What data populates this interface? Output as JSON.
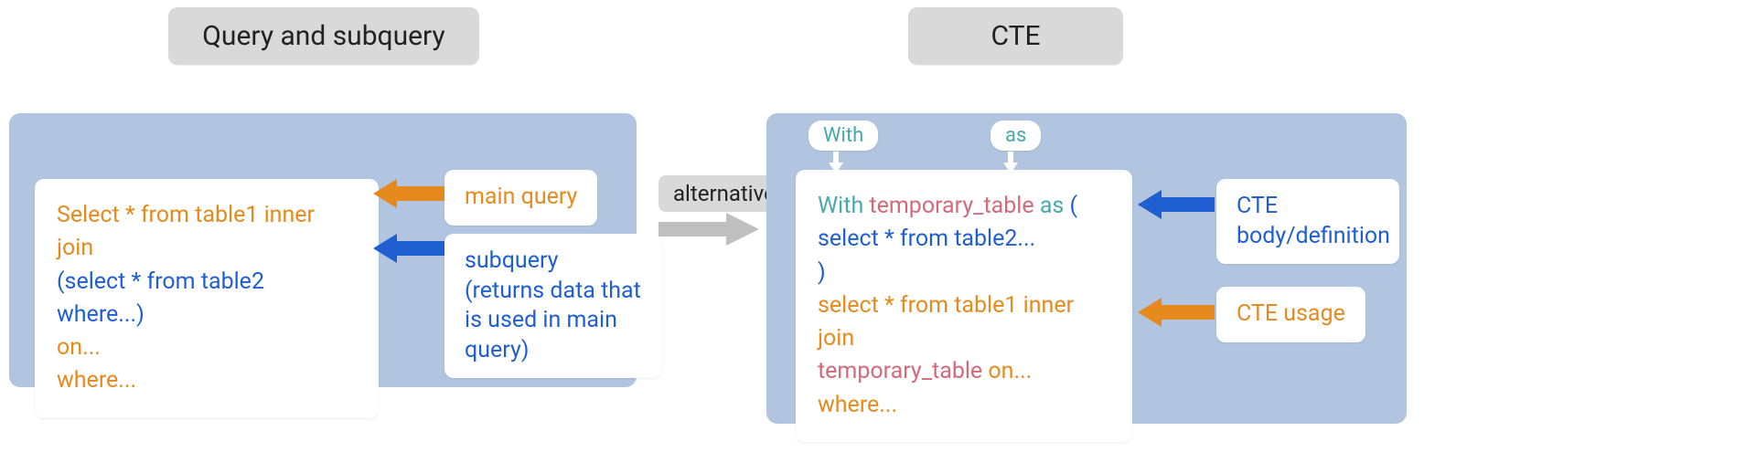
{
  "left": {
    "title": "Query and subquery",
    "code": {
      "line1": "Select * from table1 inner join",
      "line2": "(select * from table2 where...)",
      "line3": "on...",
      "line4": "where..."
    },
    "labels": {
      "main_query": "main query",
      "subquery": "subquery\n(returns data that is used in main query)"
    }
  },
  "alternative_label": "alternative",
  "right": {
    "title": "CTE",
    "pills": {
      "with": "With",
      "as": "as"
    },
    "code": {
      "l1_a": "With ",
      "l1_b": "temporary_table ",
      "l1_c": "as ",
      "l1_d": "(",
      "l2": "select * from table2...",
      "l3": ")",
      "l4": "select * from table1 inner join",
      "l5_a": "temporary_table ",
      "l5_b": "on...",
      "l6": "where..."
    },
    "labels": {
      "body": "CTE\nbody/definition",
      "usage": "CTE usage"
    }
  },
  "colors": {
    "orange_arrow": "#e68a1e",
    "blue_arrow": "#1f5fd1",
    "grey_arrow": "#bfbfbf",
    "white_arrow": "#ffffff"
  }
}
